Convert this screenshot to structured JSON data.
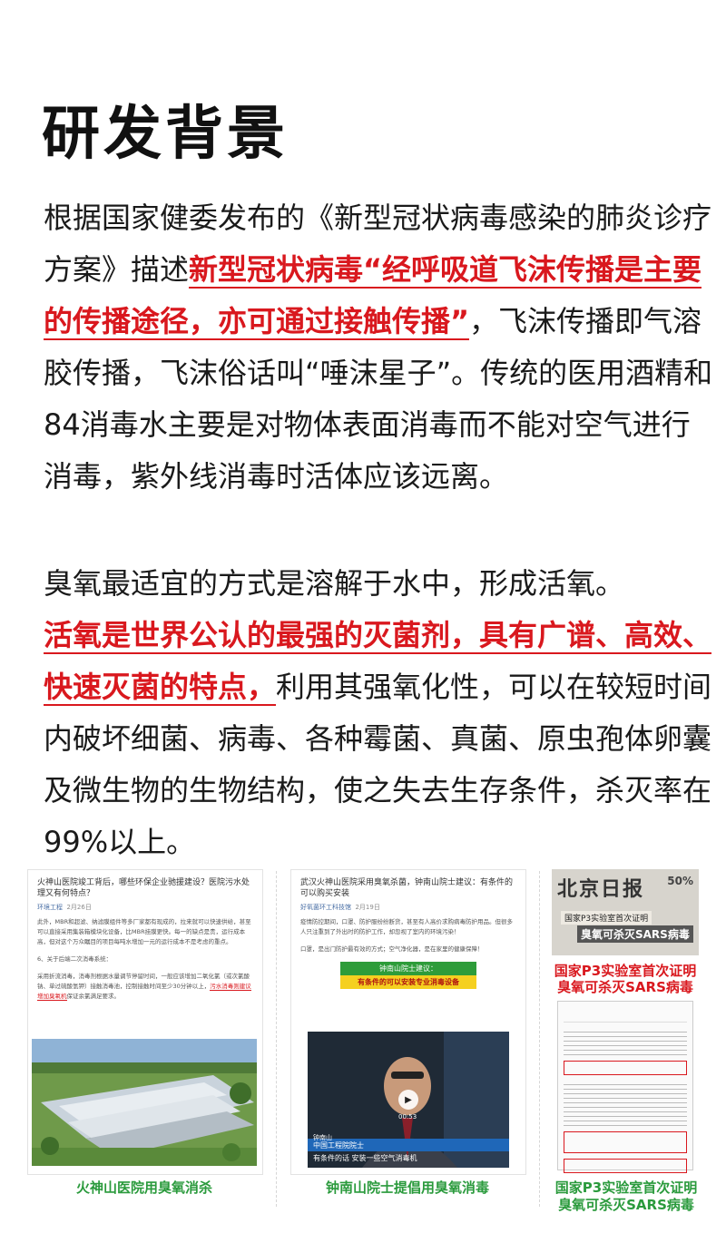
{
  "page": {
    "title": "研发背景"
  },
  "intro": {
    "p1_lead": "根据国家健委发布的《新型冠状病毒感染的肺炎诊疗方案》描述",
    "p1_highlight": "新型冠状病毒“经呼吸道飞沫传播是主要的传播途径，亦可通过接触传播”",
    "p1_tail": "，飞沫传播即气溶胶传播，飞沫俗话叫“唾沫星子”。传统的医用酒精和84消毒水主要是对物体表面消毒而不能对空气进行消毒，紫外线消毒时活体应该远离。",
    "p2_lead": "臭氧最适宜的方式是溶解于水中，形成活氧。",
    "p2_highlight": "活氧是世界公认的最强的灭菌剂，具有广谱、高效、快速灭菌的特点，",
    "p2_tail": "利用其强氧化性，可以在较短时间内破坏细菌、病毒、各种霉菌、真菌、原虫孢体卵囊及微生物的生物结构，使之失去生存条件，杀灭率在99%以上。"
  },
  "references": {
    "card1": {
      "headline": "火神山医院竣工背后，哪些环保企业驰援建设？医院污水处理又有何特点？",
      "source": "环境工程",
      "date": "2月26日",
      "body1": "此外，MBR和超滤、纳滤膜组件等多厂家都有现成的，拉来就可以快速供给，甚至可以直接采用集装箱模块化设备，比MBR挂膜更快。每一的缺点是贵，运行成本高，但对这个万众瞩目的项目每吨水增加一元的运行成本不是考虑的重点。",
      "body2": "6、关于后端二次消毒系统：",
      "body3": "采用折流消毒，消毒剂根据水量调节停留时间，一般应该增加二氧化氯（或次氯酸钠、单过硫酸氢钾）接触消毒池，控制接触时间至少30分钟以上，",
      "body3_red": "污水消毒则建议增加臭氧机",
      "body4": "保证余氯满足要求。",
      "caption": "火神山医院用臭氧消杀"
    },
    "card2": {
      "headline": "武汉火神山医院采用臭氧杀菌，钟南山院士建议：有条件的可以购买安装",
      "source": "好氧菌环工科技馆",
      "date": "2月19日",
      "body1": "疫情防控期间，口罩、防护服纷纷断货，甚至有人高价求购病毒防护用品。但很多人只注重到了外出时的防护工作，却忽视了室内的环境污染！",
      "body2": "口罩，是出门防护最有效的方式；空气净化器，是在家里的健康保障！",
      "banner1": "钟南山院士建议：",
      "banner2": "有条件的可以安装专业消毒设备",
      "lower_name": "钟南山",
      "lower_title": "中国工程院院士",
      "video_time": "00:53",
      "subtitle": "有条件的话 安装一些空气消毒机",
      "caption": "钟南山院士提倡用臭氧消毒"
    },
    "card3": {
      "masthead": "北京日报",
      "badge": "50%",
      "clip1": "国家P3实验室首次证明",
      "clip2": "臭氧可杀灭SARS病毒",
      "news_title_1": "国家P3实验室首次证明",
      "news_title_2": "臭氧可杀灭SARS病毒",
      "caption_1": "国家P3实验室首次证明",
      "caption_2": "臭氧可杀灭SARS病毒"
    }
  },
  "colors": {
    "accent_red": "#d9181e",
    "caption_green": "#2a9a3c"
  }
}
